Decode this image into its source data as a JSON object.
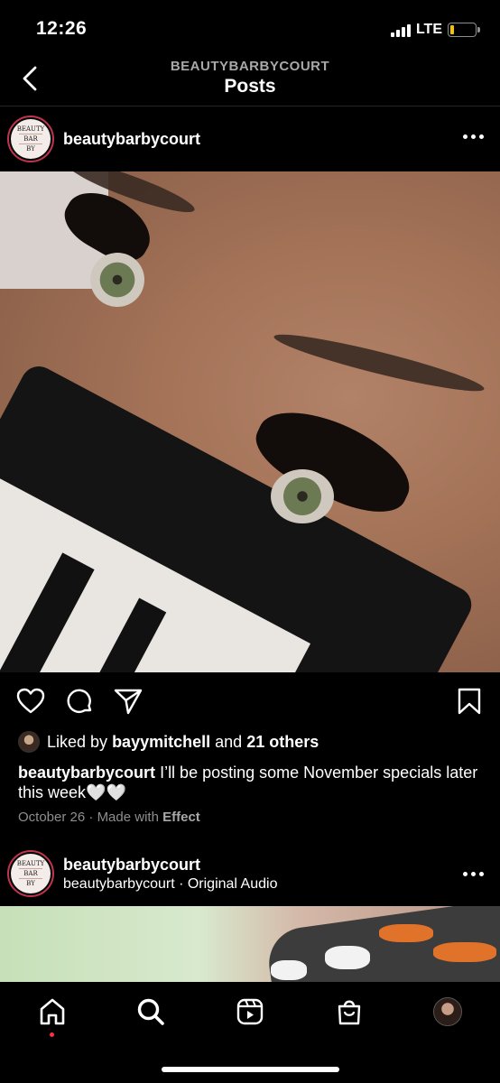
{
  "status": {
    "time": "12:26",
    "network": "LTE",
    "battery_level": 0.15
  },
  "header": {
    "subtitle": "BEAUTYBARBYCOURT",
    "title": "Posts"
  },
  "post": {
    "username": "beautybarbycourt",
    "likes": {
      "prefix": "Liked by",
      "user": "bayymitchell",
      "conj": "and",
      "others": "21 others"
    },
    "caption": {
      "user": "beautybarbycourt",
      "text": "I’ll be posting some November specials later this week🤍🤍"
    },
    "date": "October 26",
    "separator": "·",
    "made_with_prefix": "Made with",
    "made_with_effect": "Effect"
  },
  "next_post": {
    "username": "beautybarbycourt",
    "audio": "beautybarbycourt · Original Audio"
  },
  "colors": {
    "accent": "#ff3040",
    "secondary_text": "#8e8e8e",
    "divider": "#262626"
  },
  "icons": [
    "back-chevron-icon",
    "more-icon",
    "heart-icon",
    "comment-icon",
    "share-icon",
    "bookmark-icon",
    "home-icon",
    "search-icon",
    "reels-icon",
    "shop-icon",
    "profile-avatar"
  ]
}
